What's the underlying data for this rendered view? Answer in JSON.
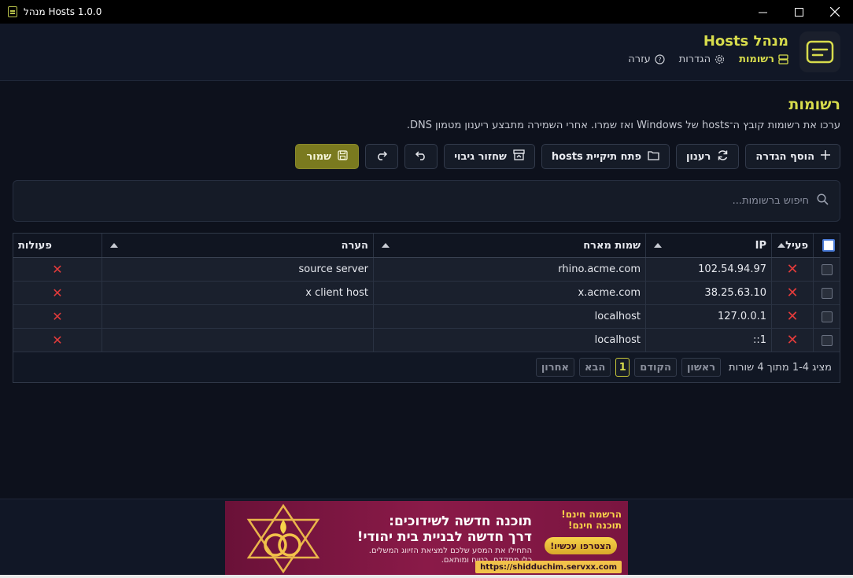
{
  "window": {
    "title": "מנהל Hosts 1.0.0",
    "minimize": "—",
    "maximize": "☐",
    "close": "✕"
  },
  "header": {
    "title": "מנהל Hosts",
    "nav": [
      {
        "label": "רשומות",
        "icon": "server-icon"
      },
      {
        "label": "הגדרות",
        "icon": "gear-icon"
      },
      {
        "label": "עזרה",
        "icon": "help-icon"
      }
    ]
  },
  "page": {
    "title": "רשומות",
    "description": "ערכו את רשומות קובץ ה־hosts של Windows ואז שמרו. אחרי השמירה מתבצע ריענון מטמון DNS."
  },
  "toolbar": {
    "add": "הוסף הגדרה",
    "refresh": "רענון",
    "open_folder": "פתח תיקיית hosts",
    "restore": "שחזור גיבוי",
    "save": "שמור"
  },
  "search": {
    "placeholder": "חיפוש ברשומות..."
  },
  "table": {
    "columns": {
      "active": "פעיל",
      "ip": "IP",
      "hostname": "שמות מארח",
      "note": "הערה",
      "actions": "פעולות"
    },
    "rows": [
      {
        "ip": "102.54.94.97",
        "hostname": "rhino.acme.com",
        "note": "source server",
        "active": false
      },
      {
        "ip": "38.25.63.10",
        "hostname": "x.acme.com",
        "note": "x client host",
        "active": false
      },
      {
        "ip": "127.0.0.1",
        "hostname": "localhost",
        "note": "",
        "active": false
      },
      {
        "ip": "::1",
        "hostname": "localhost",
        "note": "",
        "active": false
      }
    ]
  },
  "pager": {
    "info": "מציג 1-4 מתוך 4 שורות",
    "first": "ראשון",
    "prev": "הקודם",
    "current": "1",
    "next": "הבא",
    "last": "אחרון"
  },
  "banner": {
    "line1": "תוכנה חדשה לשידוכים:",
    "line2": "דרך חדשה לבניית בית יהודי!",
    "line3": "התחילו את המסע שלכם למציאת הזיווג המשלים.",
    "line4": "כלי מתקדם, בטוח ומותאם.",
    "reg1": "הרשמה חינם!",
    "reg2": "תוכנה חינם!",
    "join": "הצטרפו עכשיו!",
    "url": "https://shidduchim.servxx.com"
  },
  "colors": {
    "accent": "#d7dc4c",
    "save_bg": "#7a7a1f",
    "danger": "#e23b3b",
    "background": "#0d111c"
  }
}
